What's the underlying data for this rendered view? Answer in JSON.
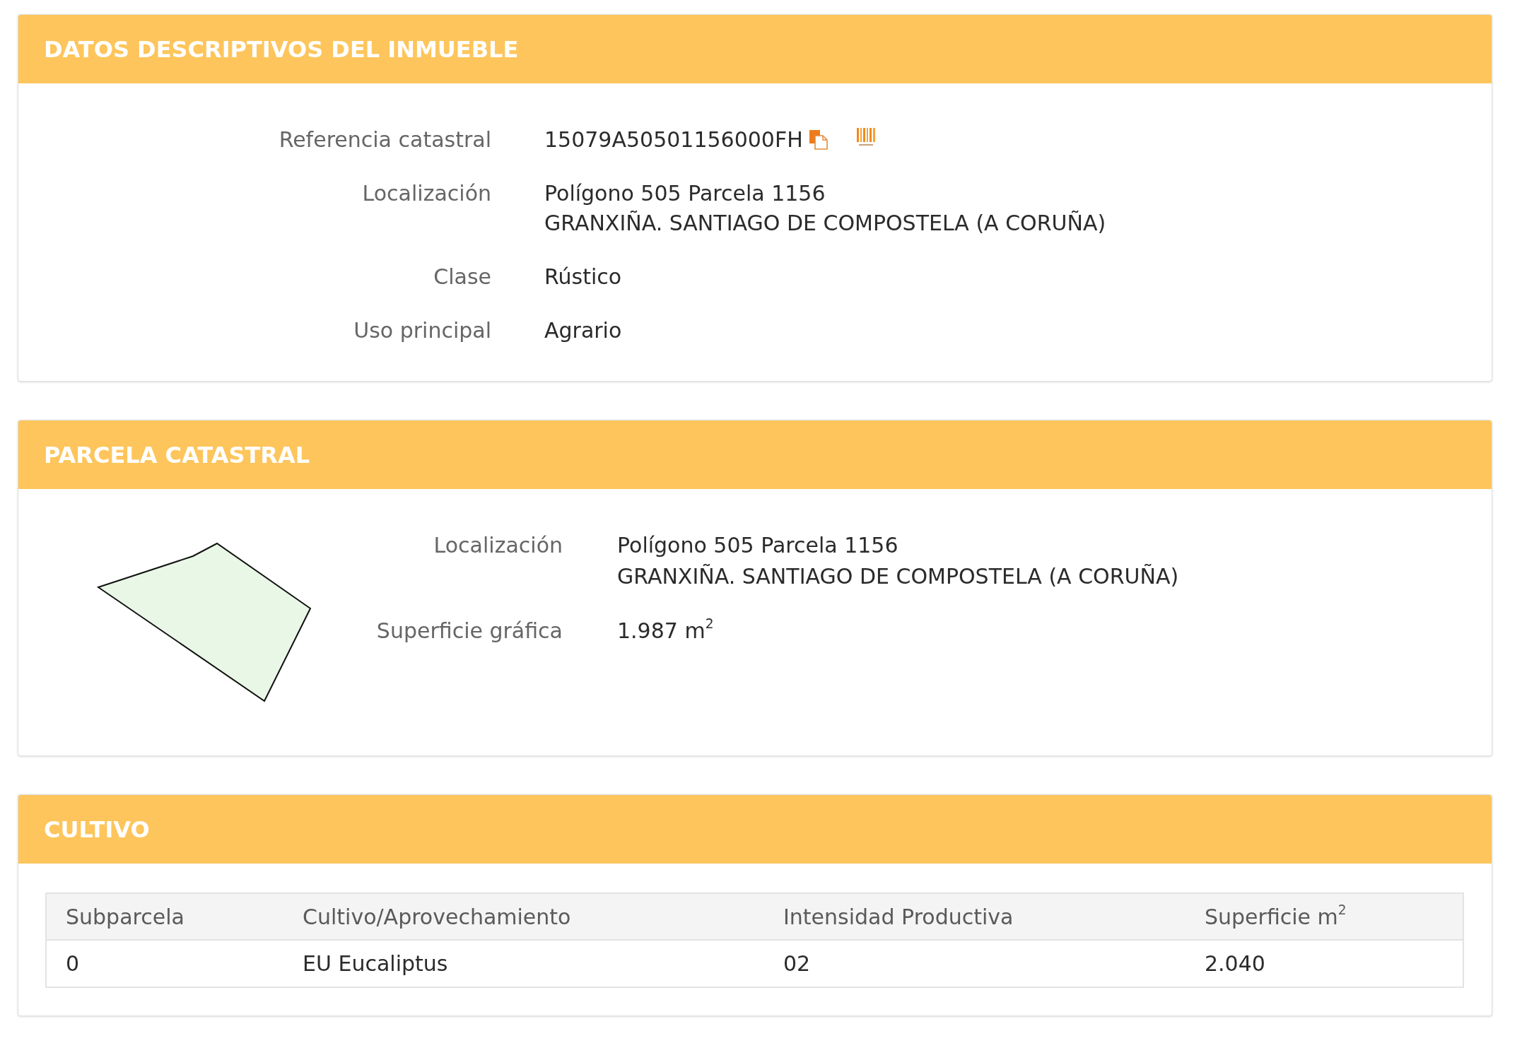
{
  "panels": [
    {
      "kind": "details",
      "title": "DATOS DESCRIPTIVOS DEL INMUEBLE",
      "fields": [
        {
          "kind": "reference",
          "label": "Referencia catastral",
          "lines": [
            "15079A50501156000FH"
          ]
        },
        {
          "kind": "text",
          "label": "Localización",
          "lines": [
            "Polígono 505 Parcela 1156",
            "GRANXIÑA. SANTIAGO DE COMPOSTELA (A CORUÑA)"
          ]
        },
        {
          "kind": "text",
          "label": "Clase",
          "lines": [
            "Rústico"
          ]
        },
        {
          "kind": "text",
          "label": "Uso principal",
          "lines": [
            "Agrario"
          ]
        }
      ]
    },
    {
      "kind": "parcel",
      "title": "PARCELA CATASTRAL",
      "fields": [
        {
          "kind": "text",
          "label": "Localización",
          "lines": [
            "Polígono 505 Parcela 1156",
            "GRANXIÑA. SANTIAGO DE COMPOSTELA (A CORUÑA)"
          ]
        },
        {
          "kind": "text",
          "label": "Superficie gráfica",
          "lines": [
            "1.987 m$^{2}$"
          ]
        }
      ]
    },
    {
      "kind": "table",
      "title": "CULTIVO",
      "columns": [
        "Subparcela",
        "Cultivo/Aprovechamiento",
        "Intensidad Productiva",
        "Superficie m$^{2}$"
      ],
      "rows": [
        [
          "0",
          "EU Eucaliptus",
          "02",
          "2.040"
        ]
      ]
    }
  ]
}
